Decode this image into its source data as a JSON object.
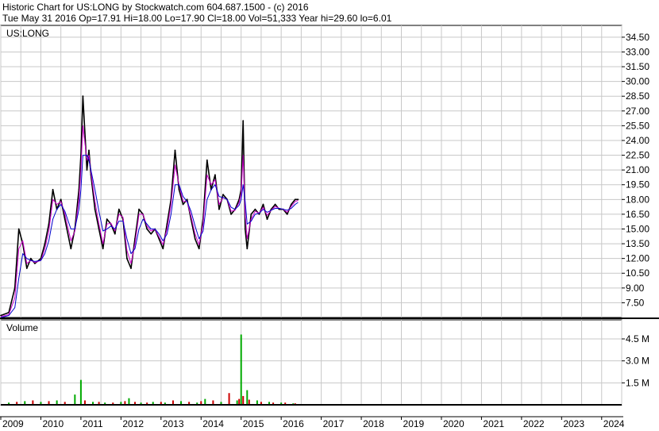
{
  "header": {
    "line1": "Historic Chart for US:LONG by Stockwatch.com 604.687.1500 - (c) 2016",
    "line2": "Tue May 31 2016  Op=17.91  Hi=18.00  Lo=17.90  Cl=18.00  Vol=51,333  Year hi=29.60  lo=6.01"
  },
  "chart_data": [
    {
      "type": "line",
      "title": "US:LONG",
      "ylim": [
        6.0,
        35.7
      ],
      "yticks": [
        "7.50",
        "9.00",
        "10.50",
        "12.00",
        "13.50",
        "15.00",
        "16.50",
        "18.00",
        "19.50",
        "21.00",
        "22.50",
        "24.00",
        "25.50",
        "27.00",
        "28.50",
        "30.00",
        "31.50",
        "33.00",
        "34.50"
      ],
      "xticks": [
        "2009",
        "2010",
        "2011",
        "2012",
        "2013",
        "2014",
        "2015",
        "2016",
        "2017",
        "2018",
        "2019",
        "2020",
        "2021",
        "2022",
        "2023",
        "2024"
      ],
      "xlim": [
        2009.0,
        2024.5
      ],
      "grid": true,
      "series": [
        {
          "color": "#000000",
          "x": [
            2009.0,
            2009.2,
            2009.35,
            2009.45,
            2009.55,
            2009.65,
            2009.75,
            2009.85,
            2010.0,
            2010.1,
            2010.2,
            2010.3,
            2010.4,
            2010.5,
            2010.6,
            2010.75,
            2010.85,
            2010.95,
            2011.0,
            2011.05,
            2011.15,
            2011.2,
            2011.25,
            2011.35,
            2011.45,
            2011.55,
            2011.65,
            2011.75,
            2011.85,
            2011.95,
            2012.05,
            2012.15,
            2012.25,
            2012.35,
            2012.45,
            2012.55,
            2012.65,
            2012.75,
            2012.85,
            2012.95,
            2013.05,
            2013.15,
            2013.25,
            2013.35,
            2013.45,
            2013.55,
            2013.65,
            2013.75,
            2013.85,
            2013.95,
            2014.05,
            2014.15,
            2014.25,
            2014.35,
            2014.45,
            2014.55,
            2014.65,
            2014.75,
            2014.85,
            2014.95,
            2015.0,
            2015.05,
            2015.1,
            2015.15,
            2015.25,
            2015.35,
            2015.45,
            2015.55,
            2015.65,
            2015.75,
            2015.85,
            2015.95,
            2016.05,
            2016.15,
            2016.25,
            2016.35,
            2016.42
          ],
          "values": [
            6.2,
            6.5,
            9.0,
            15.0,
            13.5,
            11.0,
            12.0,
            11.5,
            12.0,
            13.5,
            15.5,
            19.0,
            17.0,
            18.0,
            16.0,
            13.0,
            15.0,
            19.0,
            22.5,
            28.5,
            21.0,
            23.0,
            20.5,
            17.0,
            15.0,
            13.0,
            16.0,
            15.5,
            14.5,
            17.0,
            16.0,
            12.0,
            11.0,
            14.0,
            17.0,
            16.5,
            15.0,
            14.5,
            15.0,
            14.0,
            13.0,
            15.5,
            18.0,
            23.0,
            19.0,
            17.5,
            18.0,
            16.0,
            14.0,
            13.0,
            16.0,
            22.0,
            19.0,
            20.5,
            17.0,
            18.5,
            18.0,
            16.5,
            17.0,
            18.0,
            19.0,
            26.0,
            15.0,
            13.0,
            16.5,
            17.0,
            16.5,
            17.5,
            16.0,
            17.0,
            17.5,
            17.0,
            17.0,
            16.5,
            17.5,
            18.0,
            18.0
          ]
        },
        {
          "color": "#cc00cc",
          "x": [
            2009.0,
            2009.2,
            2009.35,
            2009.45,
            2009.55,
            2009.65,
            2009.75,
            2009.85,
            2010.0,
            2010.1,
            2010.2,
            2010.3,
            2010.4,
            2010.5,
            2010.6,
            2010.75,
            2010.85,
            2010.95,
            2011.0,
            2011.05,
            2011.15,
            2011.2,
            2011.25,
            2011.35,
            2011.45,
            2011.55,
            2011.65,
            2011.75,
            2011.85,
            2011.95,
            2012.05,
            2012.15,
            2012.25,
            2012.35,
            2012.45,
            2012.55,
            2012.65,
            2012.75,
            2012.85,
            2012.95,
            2013.05,
            2013.15,
            2013.25,
            2013.35,
            2013.45,
            2013.55,
            2013.65,
            2013.75,
            2013.85,
            2013.95,
            2014.05,
            2014.15,
            2014.25,
            2014.35,
            2014.45,
            2014.55,
            2014.65,
            2014.75,
            2014.85,
            2014.95,
            2015.0,
            2015.05,
            2015.1,
            2015.15,
            2015.25,
            2015.35,
            2015.45,
            2015.55,
            2015.65,
            2015.75,
            2015.85,
            2015.95,
            2016.05,
            2016.15,
            2016.25,
            2016.35,
            2016.42
          ],
          "values": [
            6.1,
            6.3,
            8.0,
            13.0,
            13.8,
            11.5,
            11.8,
            11.6,
            11.8,
            13.0,
            14.8,
            18.0,
            17.5,
            17.8,
            16.5,
            13.8,
            14.8,
            18.0,
            21.0,
            25.5,
            22.0,
            22.5,
            20.8,
            17.8,
            15.5,
            13.5,
            15.5,
            15.6,
            14.8,
            16.5,
            16.2,
            12.8,
            11.5,
            13.5,
            16.5,
            16.5,
            15.3,
            14.8,
            15.0,
            14.2,
            13.4,
            15.0,
            17.5,
            21.5,
            19.5,
            17.8,
            17.8,
            16.3,
            14.5,
            13.4,
            15.5,
            20.5,
            19.5,
            20.0,
            17.5,
            18.2,
            18.0,
            16.8,
            16.9,
            17.7,
            18.6,
            22.5,
            16.5,
            14.0,
            16.0,
            16.8,
            16.6,
            17.2,
            16.4,
            16.9,
            17.3,
            17.1,
            17.0,
            16.7,
            17.3,
            17.8,
            17.9
          ]
        },
        {
          "color": "#0000cc",
          "x": [
            2009.0,
            2009.2,
            2009.35,
            2009.45,
            2009.55,
            2009.65,
            2009.75,
            2009.85,
            2010.0,
            2010.1,
            2010.2,
            2010.3,
            2010.4,
            2010.5,
            2010.6,
            2010.75,
            2010.85,
            2010.95,
            2011.0,
            2011.05,
            2011.15,
            2011.2,
            2011.25,
            2011.35,
            2011.45,
            2011.55,
            2011.65,
            2011.75,
            2011.85,
            2011.95,
            2012.05,
            2012.15,
            2012.25,
            2012.35,
            2012.45,
            2012.55,
            2012.65,
            2012.75,
            2012.85,
            2012.95,
            2013.05,
            2013.15,
            2013.25,
            2013.35,
            2013.45,
            2013.55,
            2013.65,
            2013.75,
            2013.85,
            2013.95,
            2014.05,
            2014.15,
            2014.25,
            2014.35,
            2014.45,
            2014.55,
            2014.65,
            2014.75,
            2014.85,
            2014.95,
            2015.0,
            2015.05,
            2015.1,
            2015.15,
            2015.25,
            2015.35,
            2015.45,
            2015.55,
            2015.65,
            2015.75,
            2015.85,
            2015.95,
            2016.05,
            2016.15,
            2016.25,
            2016.35,
            2016.42
          ],
          "values": [
            6.0,
            6.2,
            7.0,
            10.0,
            12.5,
            12.0,
            11.8,
            11.7,
            11.8,
            12.5,
            13.8,
            16.0,
            17.0,
            17.5,
            16.8,
            15.0,
            15.0,
            17.0,
            19.0,
            22.5,
            22.5,
            22.0,
            21.0,
            19.0,
            16.8,
            14.8,
            15.0,
            15.3,
            15.0,
            15.8,
            15.8,
            14.0,
            12.5,
            13.0,
            15.0,
            16.0,
            15.5,
            15.0,
            15.0,
            14.5,
            13.8,
            14.5,
            16.5,
            19.5,
            19.5,
            18.3,
            17.8,
            16.8,
            15.3,
            14.0,
            14.8,
            18.0,
            19.0,
            19.5,
            18.3,
            18.2,
            18.0,
            17.2,
            17.0,
            17.4,
            18.0,
            19.5,
            17.8,
            15.5,
            15.8,
            16.5,
            16.6,
            17.0,
            16.7,
            16.9,
            17.1,
            17.1,
            17.0,
            16.9,
            17.1,
            17.5,
            17.7
          ]
        }
      ]
    },
    {
      "type": "bar",
      "title": "Volume",
      "ylim": [
        0,
        5.8
      ],
      "yunit": "M",
      "yticks": [
        "1.5 M",
        "3.0 M",
        "4.5 M"
      ],
      "xticks": [
        "2009",
        "2010",
        "2011",
        "2012",
        "2013",
        "2014",
        "2015",
        "2016",
        "2017",
        "2018",
        "2019",
        "2020",
        "2021",
        "2022",
        "2023",
        "2024"
      ],
      "xlim": [
        2009.0,
        2024.5
      ],
      "series": [
        {
          "name": "up",
          "color": "#00aa00",
          "x": [
            2009.2,
            2009.6,
            2010.0,
            2010.4,
            2010.85,
            2011.0,
            2011.3,
            2011.6,
            2012.0,
            2012.2,
            2012.5,
            2012.8,
            2013.1,
            2013.5,
            2013.9,
            2014.1,
            2014.5,
            2014.9,
            2015.0,
            2015.15,
            2015.4,
            2015.7,
            2016.0,
            2016.3
          ],
          "values": [
            0.15,
            0.25,
            0.2,
            0.3,
            0.7,
            1.7,
            0.2,
            0.15,
            0.2,
            0.45,
            0.15,
            0.2,
            0.15,
            0.25,
            0.15,
            0.4,
            0.2,
            0.3,
            4.8,
            1.0,
            0.3,
            0.2,
            0.15,
            0.1
          ]
        },
        {
          "name": "down",
          "color": "#cc0000",
          "x": [
            2009.4,
            2009.8,
            2010.2,
            2010.6,
            2011.1,
            2011.45,
            2011.8,
            2012.1,
            2012.35,
            2012.65,
            2013.0,
            2013.3,
            2013.7,
            2014.0,
            2014.3,
            2014.7,
            2014.95,
            2015.05,
            2015.2,
            2015.5,
            2015.8,
            2016.1,
            2016.35
          ],
          "values": [
            0.2,
            0.3,
            0.25,
            0.2,
            0.3,
            0.2,
            0.15,
            0.25,
            0.2,
            0.15,
            0.2,
            0.3,
            0.2,
            0.25,
            0.3,
            0.8,
            0.4,
            0.6,
            0.35,
            0.2,
            0.15,
            0.15,
            0.1
          ]
        }
      ]
    }
  ]
}
